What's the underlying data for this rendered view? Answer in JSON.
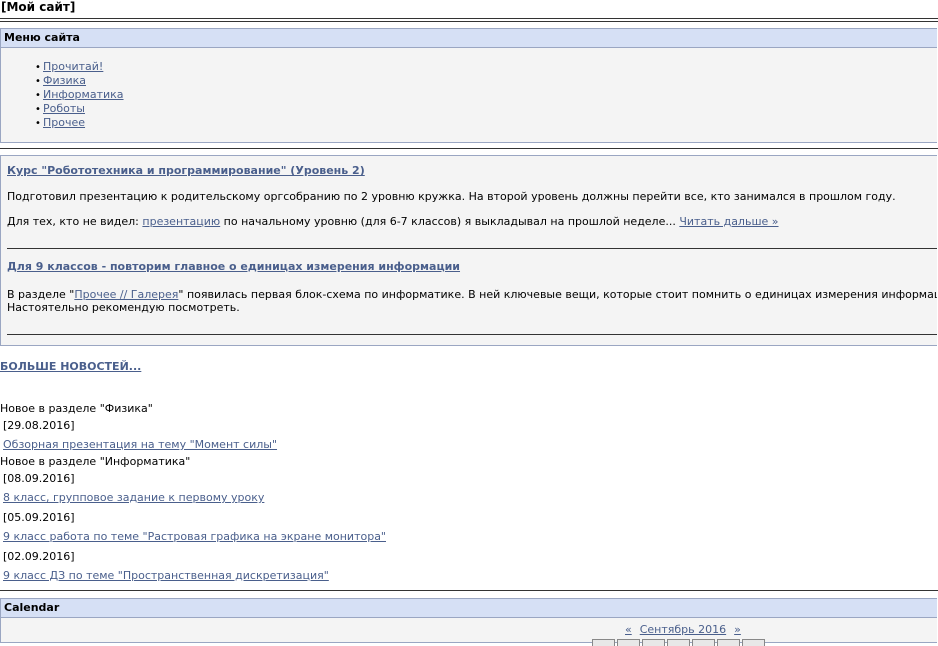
{
  "site": {
    "title": "[Мой сайт]"
  },
  "menu": {
    "heading": "Меню сайта",
    "items": [
      {
        "label": "Прочитай!"
      },
      {
        "label": "Физика"
      },
      {
        "label": "Информатика"
      },
      {
        "label": "Роботы"
      },
      {
        "label": "Прочее"
      }
    ]
  },
  "news": [
    {
      "title": "Курс \"Робототехника и программирование\" (Уровень 2)",
      "p1": "Подготовил презентацию к родительскому оргсобранию по 2 уровню кружка. На второй уровень должны перейти все, кто занимался в прошлом году.",
      "p2_before": "Для тех, кто не видел: ",
      "p2_link": "презентацию",
      "p2_after": " по начальному уровню (для 6-7 классов) я выкладывал на прошлой неделе... ",
      "read_more": "Читать дальше »"
    },
    {
      "title": "Для 9 классов - повторим главное о единицах измерения информации",
      "p1_before": "В разделе \"",
      "p1_link": "Прочее // Галерея",
      "p1_after": "\" появилась первая блок-схема по информатике. В ней ключевые вещи, которые стоит помнить о единицах измерения информации: битах, байтах и кра",
      "p2": "Настоятельно рекомендую посмотреть."
    }
  ],
  "more_news": "БОЛЬШЕ НОВОСТЕЙ...",
  "physics": {
    "heading": "Новое в разделе \"Физика\"",
    "entries": [
      {
        "date": "[29.08.2016]",
        "link": "Обзорная презентация на тему \"Момент силы\""
      }
    ]
  },
  "informatics": {
    "heading": "Новое в разделе \"Информатика\"",
    "entries": [
      {
        "date": "[08.09.2016]",
        "link": "8 класс, групповое задание к первому уроку"
      },
      {
        "date": "[05.09.2016]",
        "link": "9 класс работа по теме \"Растровая графика на экране монитора\""
      },
      {
        "date": "[02.09.2016]",
        "link": "9 класс ДЗ по теме \"Пространственная дискретизация\""
      }
    ]
  },
  "calendar": {
    "heading": "Calendar",
    "prev": "«",
    "month": "Сентябрь 2016",
    "next": "»"
  }
}
